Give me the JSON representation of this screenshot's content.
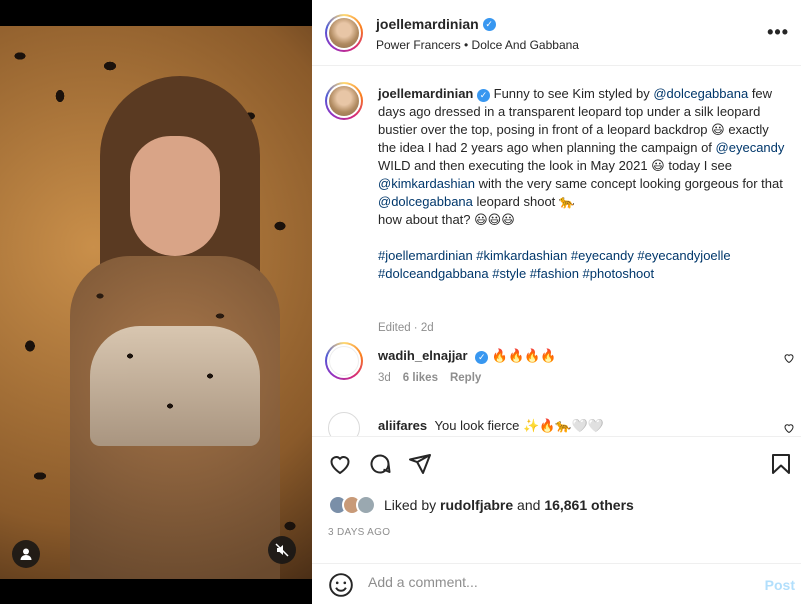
{
  "post": {
    "author": "joellemardinian",
    "location": "Power Francers • Dolce And Gabbana"
  },
  "caption": {
    "author": "joellemardinian",
    "p1": "Funny to see Kim styled by ",
    "m1": "@dolcegabbana",
    "p2": " few days ago dressed in a transparent leopard top under a silk leopard bustier over the top, posing in front of a leopard backdrop 😃 exactly the idea I had 2 years ago when planning the campaign of ",
    "m2": "@eyecandy",
    "p3": " WILD and then executing the look in May 2021 😃 today I see ",
    "m3": "@kimkardashian",
    "p4": " with the very same concept looking gorgeous for that ",
    "m4": "@dolcegabbana",
    "p5": " leopard shoot 🐆",
    "p6": "how about that? 😃😃😃",
    "hashtags": "#joellemardinian #kimkardashian #eyecandy #eyecandyjoelle #dolceandgabbana #style #fashion #photoshoot",
    "edited": "Edited · 2d"
  },
  "comments": [
    {
      "user": "wadih_elnajjar",
      "text": "🔥🔥🔥🔥",
      "time": "3d",
      "likes": "6 likes",
      "reply": "Reply"
    },
    {
      "user": "aliifares",
      "text": "You look fierce ✨🔥🐆🤍🤍"
    }
  ],
  "likes": {
    "prefix": "Liked by ",
    "user": "rudolfjabre",
    "middle": " and ",
    "count": "16,861 others"
  },
  "date": "3 DAYS AGO",
  "add_comment": {
    "placeholder": "Add a comment...",
    "post_label": "Post"
  },
  "icons": {
    "verified": "✓",
    "more": "•••"
  },
  "colors": {
    "link": "#00376b",
    "verified": "#3897f0",
    "post_disabled": "#b2dffc",
    "muted": "#8e8e8e"
  }
}
